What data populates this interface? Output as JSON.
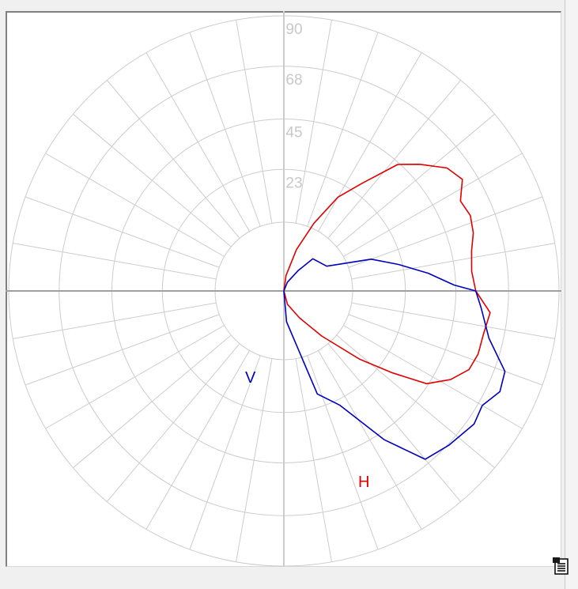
{
  "chart_data": {
    "type": "polar-line",
    "radial_ticks": [
      "23",
      "45",
      "68",
      "90"
    ],
    "radial_max": 90,
    "angular_step_deg": 10,
    "series": [
      {
        "name": "H",
        "color": "#e00000",
        "points": [
          [
            0,
            0
          ],
          [
            15,
            4.5
          ],
          [
            30,
            10
          ],
          [
            40,
            19
          ],
          [
            48,
            33
          ],
          [
            53,
            44
          ],
          [
            57,
            55
          ],
          [
            62,
            61
          ],
          [
            67,
            65
          ],
          [
            72,
            66
          ],
          [
            78,
            66
          ],
          [
            84,
            67
          ],
          [
            90,
            62
          ],
          [
            96,
            61
          ],
          [
            102,
            62
          ],
          [
            107,
            64
          ],
          [
            112,
            65
          ],
          [
            117,
            64
          ],
          [
            122,
            68
          ],
          [
            127,
            66
          ],
          [
            133,
            60
          ],
          [
            138,
            55
          ],
          [
            144,
            43
          ],
          [
            150,
            35
          ],
          [
            156,
            24
          ],
          [
            163,
            14
          ],
          [
            172,
            5
          ],
          [
            180,
            0
          ]
        ]
      },
      {
        "name": "V",
        "color": "#0000c0",
        "points": [
          [
            0,
            0
          ],
          [
            158,
            3
          ],
          [
            145,
            8
          ],
          [
            138,
            14
          ],
          [
            120,
            16
          ],
          [
            110,
            30
          ],
          [
            103,
            38
          ],
          [
            97,
            47
          ],
          [
            92,
            55
          ],
          [
            90,
            62
          ],
          [
            85,
            64
          ],
          [
            77,
            68
          ],
          [
            70,
            76
          ],
          [
            65,
            77
          ],
          [
            60,
            74
          ],
          [
            55,
            75
          ],
          [
            47,
            73
          ],
          [
            40,
            71
          ],
          [
            34,
            58
          ],
          [
            26,
            41
          ],
          [
            18,
            35
          ],
          [
            5,
            10
          ],
          [
            0,
            0
          ]
        ]
      }
    ]
  },
  "colors": {
    "grid": "#cccccc",
    "axis": "#a0a0a0",
    "background": "#ffffff"
  },
  "report_button": {
    "icon": "report-list-icon"
  }
}
